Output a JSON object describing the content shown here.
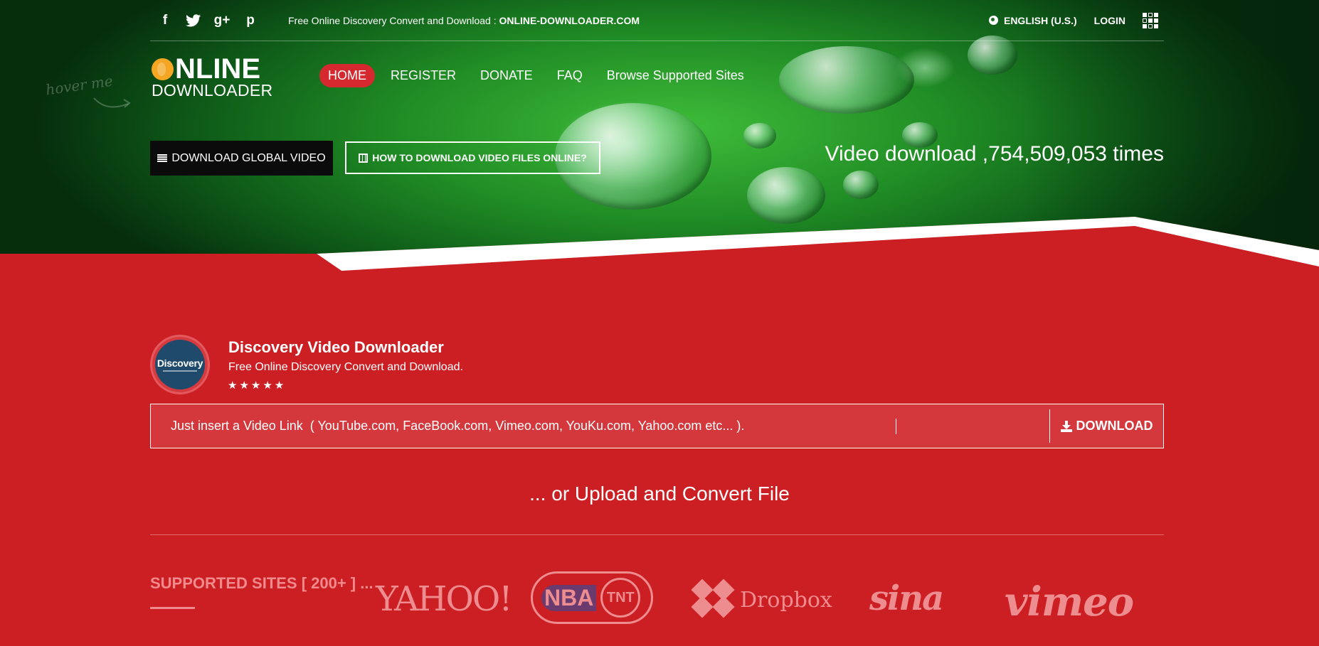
{
  "topbar": {
    "social_icons": [
      "facebook-icon",
      "twitter-icon",
      "google-plus-icon",
      "pinterest-icon"
    ],
    "social_glyphs": {
      "facebook": "f",
      "twitter": "t",
      "googleplus": "g+",
      "pinterest": "p"
    },
    "tagline_prefix": "Free Online Discovery Convert and Download : ",
    "tagline_site": "ONLINE-DOWNLOADER.COM",
    "language": "ENGLISH (U.S.)",
    "login": "LOGIN"
  },
  "logo": {
    "line1_rest": "NLINE",
    "line2": "DOWNLOADER",
    "hover_hint": "hover me"
  },
  "nav": [
    {
      "label": "HOME",
      "active": true
    },
    {
      "label": "REGISTER",
      "active": false
    },
    {
      "label": "DONATE",
      "active": false
    },
    {
      "label": "FAQ",
      "active": false
    },
    {
      "label": "Browse Supported Sites",
      "active": false
    }
  ],
  "actions": {
    "download_global": "DOWNLOAD GLOBAL VIDEO",
    "how_to": "HOW TO DOWNLOAD VIDEO FILES ONLINE?"
  },
  "counter": "Video download ,754,509,053 times",
  "downloader": {
    "avatar_brand": "Discovery",
    "title": "Discovery Video Downloader",
    "description": "Free Online Discovery Convert and Download.",
    "stars": "★★★★★",
    "rating": 5
  },
  "search": {
    "placeholder": "Just insert a Video Link  ( YouTube.com, FaceBook.com, Vimeo.com, YouKu.com, Yahoo.com etc... ).",
    "button": "DOWNLOAD"
  },
  "upload_text": "... or Upload and Convert File",
  "supported": {
    "label": "SUPPORTED SITES [ 200+ ] ...",
    "sites": {
      "yahoo": "YAHOO!",
      "nba": "NBA",
      "tnt": "TNT",
      "dropbox": "Dropbox",
      "sina": "sina",
      "vimeo": "vimeo"
    }
  },
  "colors": {
    "brand_red": "#cc1f24",
    "nav_active": "#d5282f",
    "logo_accent": "#f5a623",
    "supported_text": "#f08a8d"
  }
}
